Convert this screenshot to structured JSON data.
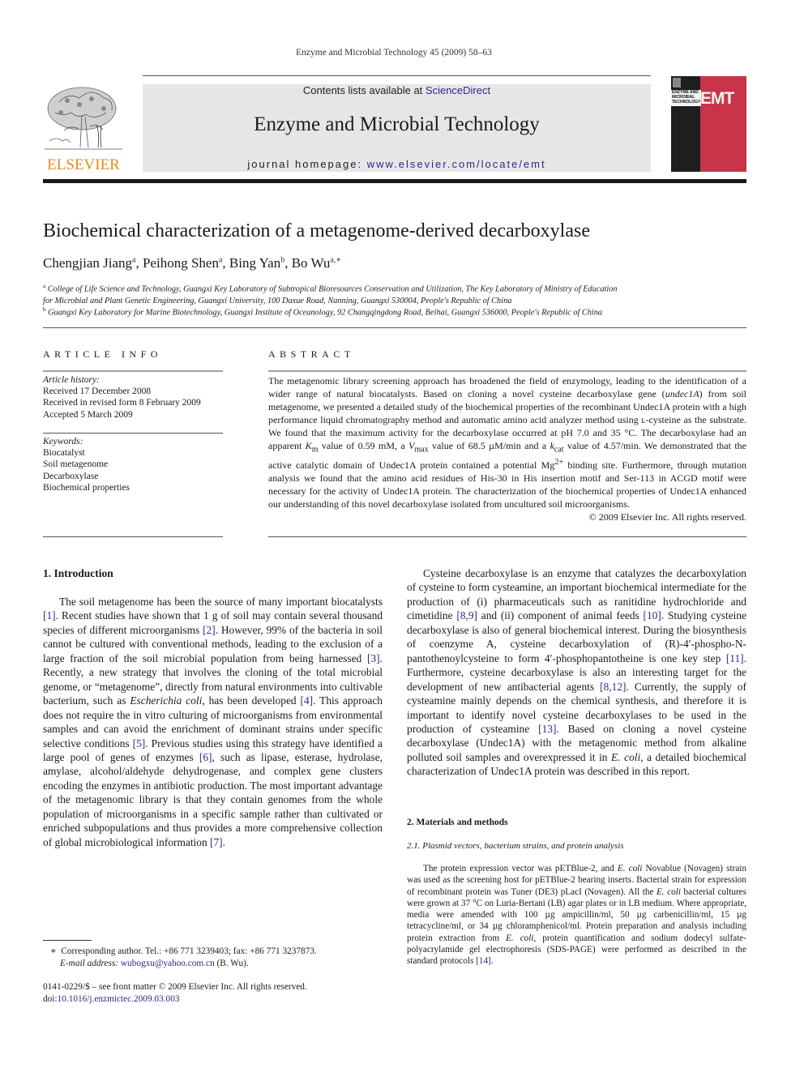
{
  "running_head": "Enzyme and Microbial Technology 45 (2009) 58–63",
  "publisher": {
    "name": "ELSEVIER",
    "logo_icon": "elsevier-tree-icon",
    "color": "#e88a1a"
  },
  "banner": {
    "contents_prefix": "Contents lists available at ",
    "contents_link": "ScienceDirect",
    "journal_title": "Enzyme and Microbial Technology",
    "homepage_prefix": "journal homepage: ",
    "homepage_link": "www.elsevier.com/locate/emt",
    "background": "#e6e6e8"
  },
  "cover": {
    "band_text": "ENZYME AND MICROBIAL TECHNOLOGY",
    "acronym": "EMT",
    "red": "#c8344a",
    "dark": "#1e1e1e"
  },
  "article": {
    "title": "Biochemical characterization of a metagenome-derived decarboxylase",
    "authors": [
      {
        "name": "Chengjian Jiang",
        "sup": "a"
      },
      {
        "name": "Peihong Shen",
        "sup": "a"
      },
      {
        "name": "Bing Yan",
        "sup": "b"
      },
      {
        "name": "Bo Wu",
        "sup": "a,∗"
      }
    ],
    "affiliations": [
      {
        "sup": "a",
        "line1": "College of Life Science and Technology, Guangxi Key Laboratory of Subtropical Bioresources Conservation and Utilization, The Key Laboratory of Ministry of Education",
        "line2": "for Microbial and Plant Genetic Engineering, Guangxi University, 100 Daxue Road, Nanning, Guangxi 530004, People's Republic of China"
      },
      {
        "sup": "b",
        "line1": "Guangxi Key Laboratory for Marine Biotechnology, Guangxi Institute of Oceanology, 92 Changqingdong Road, Beihai, Guangxi 536000, People's Republic of China"
      }
    ]
  },
  "article_info": {
    "heading": "ARTICLE INFO",
    "history_label": "Article history:",
    "history": [
      "Received 17 December 2008",
      "Received in revised form 8 February 2009",
      "Accepted 5 March 2009"
    ],
    "keywords_label": "Keywords:",
    "keywords": [
      "Biocatalyst",
      "Soil metagenome",
      "Decarboxylase",
      "Biochemical properties"
    ]
  },
  "abstract": {
    "heading": "ABSTRACT",
    "p1": "The metagenomic library screening approach has broadened the field of enzymology, leading to the identification of a wider range of natural biocatalysts. Based on cloning a novel cysteine decarboxylase gene (",
    "gene": "undec1A",
    "p2": ") from soil metagenome, we presented a detailed study of the biochemical properties of the recombinant Undec1A protein with a high performance liquid chromatography method and automatic amino acid analyzer method using ʟ-cysteine as the substrate. We found that the maximum activity for the decarboxylase occurred at pH 7.0 and 35 °C. The decarboxylase had an apparent ",
    "km": "K",
    "km_sub": "m",
    "p3": " value of 0.59 mM, a ",
    "vmax": "V",
    "vmax_sub": "max",
    "p4": " value of 68.5 µM/min and a ",
    "kcat": "k",
    "kcat_sub": "cat",
    "p5": " value of 4.57/min. We demonstrated that the active catalytic domain of Undec1A protein contained a potential Mg",
    "mg_sup": "2+",
    "p6": " binding site. Furthermore, through mutation analysis we found that the amino acid residues of His-30 in His insertion motif and Ser-113 in ACGD motif were necessary for the activity of Undec1A protein. The characterization of the biochemical properties of Undec1A enhanced our understanding of this novel decarboxylase isolated from uncultured soil microorganisms.",
    "copyright": "© 2009 Elsevier Inc. All rights reserved."
  },
  "intro": {
    "heading": "1.  Introduction",
    "segments": [
      "The soil metagenome has been the source of many important biocatalysts ",
      "[1]",
      ". Recent studies have shown that 1 g of soil may contain several thousand species of different microorganisms ",
      "[2]",
      ". However, 99% of the bacteria in soil cannot be cultured with conventional methods, leading to the exclusion of a large fraction of the soil microbial population from being harnessed ",
      "[3]",
      ". Recently, a new strategy that involves the cloning of the total microbial genome, or “metagenome”, directly from natural environments into cultivable bacterium, such as ",
      "Escherichia coli",
      ", has been developed ",
      "[4]",
      ". This approach does not require the in vitro culturing of microorganisms from environmental samples and can avoid the enrichment of dominant strains under specific selective conditions ",
      "[5]",
      ". Previous studies using this strategy have identified a large pool of genes of enzymes ",
      "[6]",
      ", such as lipase, esterase, hydrolase, amylase, alcohol/aldehyde dehydrogenase, and complex gene clusters encoding the enzymes in antibiotic production. The most important advantage of the metagenomic library is that they contain genomes from the whole population of microorganisms in a specific sample rather than cultivated or enriched subpopulations and thus provides a more comprehensive collection of global microbiological information ",
      "[7]",
      "."
    ]
  },
  "right_col": {
    "segments": [
      "Cysteine decarboxylase is an enzyme that catalyzes the decarboxylation of cysteine to form cysteamine, an important biochemical intermediate for the production of (i) pharmaceuticals such as ranitidine hydrochloride and cimetidine ",
      "[8,9]",
      " and (ii) component of animal feeds ",
      "[10]",
      ". Studying cysteine decarboxylase is also of general biochemical interest. During the biosynthesis of coenzyme A, cysteine decarboxylation of (R)-4′-phospho-N-pantothenoylcysteine to form 4′-phosphopantotheine is one key step ",
      "[11]",
      ". Furthermore, cysteine decarboxylase is also an interesting target for the development of new antibacterial agents ",
      "[8,12]",
      ". Currently, the supply of cysteamine mainly depends on the chemical synthesis, and therefore it is important to identify novel cysteine decarboxylases to be used in the production of cysteamine ",
      "[13]",
      ". Based on cloning a novel cysteine decarboxylase (Undec1A) with the metagenomic method from alkaline polluted soil samples and overexpressed it in ",
      "E. coli",
      ", a detailed biochemical characterization of Undec1A protein was described in this report."
    ],
    "methods_heading": "2.  Materials and methods",
    "subheading": "2.1.   Plasmid vectors, bacterium strains, and protein analysis",
    "methods_segments": [
      "The protein expression vector was pETBlue-2, and ",
      "E. coli",
      " Novablue (Novagen) strain was used as the screening host for pETBlue-2 bearing inserts. Bacterial strain for expression of recombinant protein was Tuner (DE3) pLacI (Novagen). All the ",
      "E. coli",
      " bacterial cultures were grown at 37 °C on Luria-Bertani (LB) agar plates or in LB medium. Where appropriate, media were amended with 100 µg ampicillin/ml, 50 µg carbenicillin/ml, 15 µg tetracycline/ml, or 34 µg chloramphenicol/ml. Protein preparation and analysis including protein extraction from ",
      "E. coli",
      ", protein quantification and sodium dodecyl sulfate-polyacrylamide gel electrophoresis (SDS-PAGE) were performed as described in the standard protocols ",
      "[14]",
      "."
    ]
  },
  "footnote": {
    "star": "∗",
    "corresponding": "Corresponding author. Tel.: +86 771 3239403; fax: +86 771 3237873.",
    "email_label": "E-mail address: ",
    "email": "wubogxu@yahoo.com.cn",
    "email_suffix": " (B. Wu)."
  },
  "front_matter": {
    "issn_line": "0141-0229/$ – see front matter © 2009 Elsevier Inc. All rights reserved.",
    "doi_label": "doi:",
    "doi": "10.1016/j.enzmictec.2009.03.003"
  },
  "colors": {
    "link": "#2a2a8a",
    "text": "#1a1a1a"
  }
}
